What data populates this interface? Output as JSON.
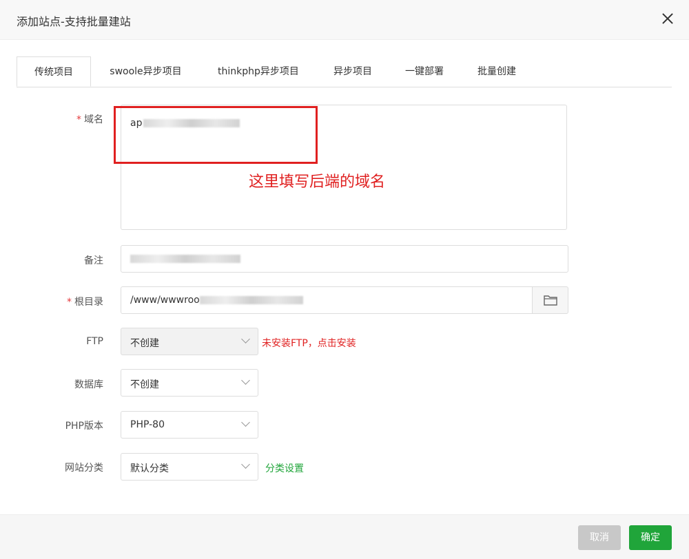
{
  "dialog": {
    "title": "添加站点-支持批量建站"
  },
  "tabs": [
    {
      "label": "传统项目",
      "active": true
    },
    {
      "label": "swoole异步项目"
    },
    {
      "label": "thinkphp异步项目"
    },
    {
      "label": "异步项目"
    },
    {
      "label": "一键部署"
    },
    {
      "label": "批量创建"
    }
  ],
  "form": {
    "domain": {
      "label": "域名",
      "value_prefix": "ap"
    },
    "annotation": "这里填写后端的域名",
    "remark": {
      "label": "备注"
    },
    "root_dir": {
      "label": "根目录",
      "value_prefix": "/www/wwwroo"
    },
    "ftp": {
      "label": "FTP",
      "value": "不创建",
      "hint": "未安装FTP，点击安装"
    },
    "database": {
      "label": "数据库",
      "value": "不创建"
    },
    "php_version": {
      "label": "PHP版本",
      "value": "PHP-80"
    },
    "category": {
      "label": "网站分类",
      "value": "默认分类",
      "link": "分类设置"
    },
    "required_mark": "*"
  },
  "footer": {
    "cancel_label": "取消",
    "ok_label": "确定"
  },
  "colors": {
    "primary": "#20a53a",
    "danger": "#e02020",
    "disabled": "#c8c8c8"
  }
}
